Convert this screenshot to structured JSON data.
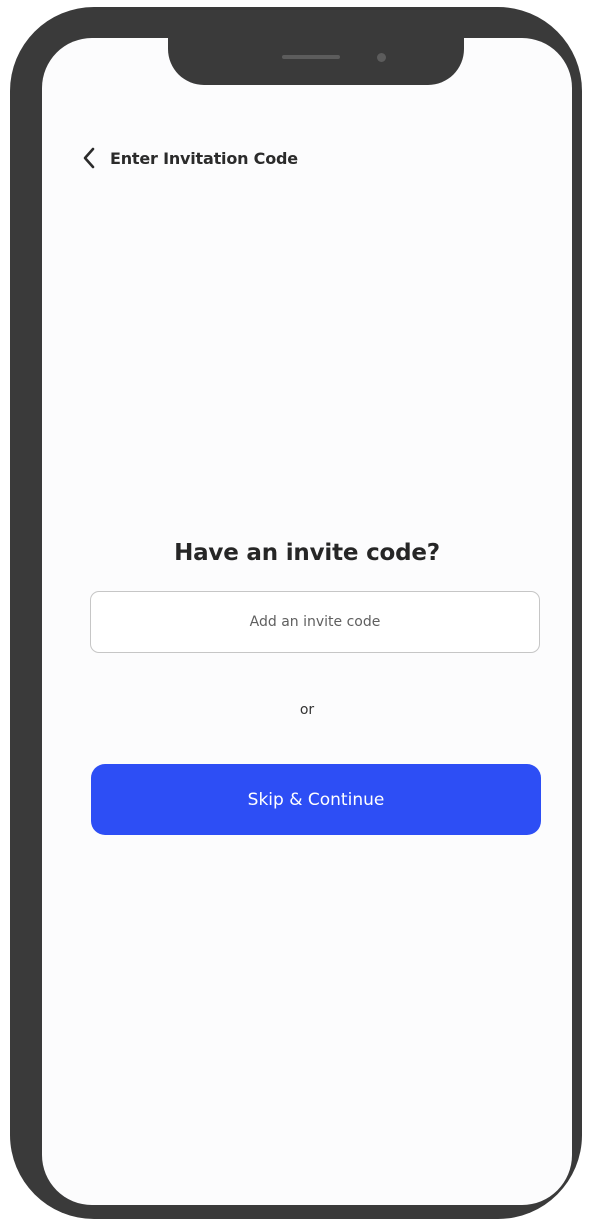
{
  "header": {
    "title": "Enter Invitation Code",
    "back_icon": "chevron-left-icon"
  },
  "invite": {
    "heading": "Have an invite code?",
    "input_value": "",
    "input_placeholder": "Add an invite code"
  },
  "divider_text": "or",
  "primary_action": {
    "label": "Skip & Continue",
    "color": "#2d4ef5"
  },
  "colors": {
    "frame": "#3a3a3a",
    "screen_background": "#fcfcfd",
    "text": "#262626"
  }
}
